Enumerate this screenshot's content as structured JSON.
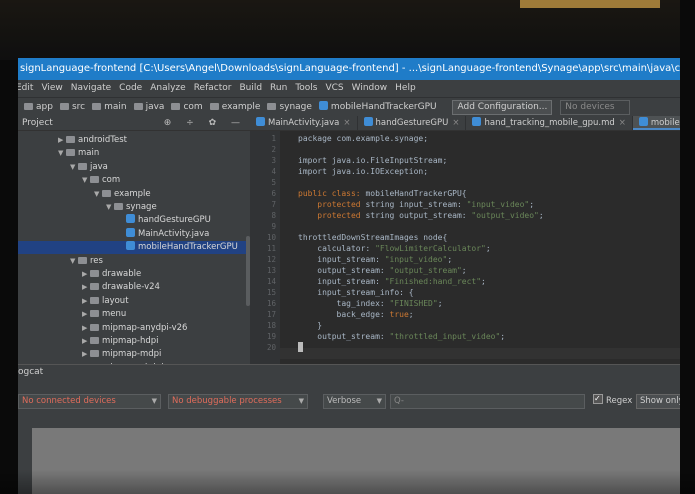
{
  "window": {
    "title": "signLanguage-frontend [C:\\Users\\Angel\\Downloads\\signLanguage-frontend] - ...\\signLanguage-frontend\\Synage\\app\\src\\main\\java\\com\\example\\synage\\mobileHandTrackerGPU"
  },
  "menu": [
    "Edit",
    "View",
    "Navigate",
    "Code",
    "Analyze",
    "Refactor",
    "Build",
    "Run",
    "Tools",
    "VCS",
    "Window",
    "Help"
  ],
  "nav": {
    "crumbs": [
      "app",
      "src",
      "main",
      "java",
      "com",
      "example",
      "synage",
      "mobileHandTrackerGPU"
    ],
    "config_label": "Add Configuration...",
    "device_label": "No devices"
  },
  "project": {
    "header": "Project",
    "tools": "⊕ ÷ ✿ —",
    "tree": [
      {
        "label": "androidTest",
        "depth": 1,
        "expanded": false,
        "kind": "folder"
      },
      {
        "label": "main",
        "depth": 1,
        "expanded": true,
        "kind": "folder"
      },
      {
        "label": "java",
        "depth": 2,
        "expanded": true,
        "kind": "folder"
      },
      {
        "label": "com",
        "depth": 3,
        "expanded": true,
        "kind": "folder"
      },
      {
        "label": "example",
        "depth": 4,
        "expanded": true,
        "kind": "folder"
      },
      {
        "label": "synage",
        "depth": 5,
        "expanded": true,
        "kind": "folder"
      },
      {
        "label": "handGestureGPU",
        "depth": 6,
        "kind": "file"
      },
      {
        "label": "MainActivity.java",
        "depth": 6,
        "kind": "file"
      },
      {
        "label": "mobileHandTrackerGPU",
        "depth": 6,
        "kind": "file",
        "selected": true
      },
      {
        "label": "res",
        "depth": 2,
        "expanded": true,
        "kind": "folder"
      },
      {
        "label": "drawable",
        "depth": 3,
        "expanded": false,
        "kind": "folder"
      },
      {
        "label": "drawable-v24",
        "depth": 3,
        "expanded": false,
        "kind": "folder"
      },
      {
        "label": "layout",
        "depth": 3,
        "expanded": false,
        "kind": "folder"
      },
      {
        "label": "menu",
        "depth": 3,
        "expanded": false,
        "kind": "folder"
      },
      {
        "label": "mipmap-anydpi-v26",
        "depth": 3,
        "expanded": false,
        "kind": "folder"
      },
      {
        "label": "mipmap-hdpi",
        "depth": 3,
        "expanded": false,
        "kind": "folder"
      },
      {
        "label": "mipmap-mdpi",
        "depth": 3,
        "expanded": false,
        "kind": "folder"
      },
      {
        "label": "mipmap-xhdpi",
        "depth": 3,
        "expanded": false,
        "kind": "folder"
      }
    ]
  },
  "tabs": [
    {
      "label": "MainActivity.java",
      "active": false
    },
    {
      "label": "handGestureGPU",
      "active": false
    },
    {
      "label": "hand_tracking_mobile_gpu.md",
      "active": false
    },
    {
      "label": "mobileHandTrackerGPU",
      "active": true
    }
  ],
  "editor": {
    "lines": [
      {
        "n": "1",
        "segs": [
          {
            "t": "package com.example.synage;",
            "c": ""
          }
        ]
      },
      {
        "n": "2",
        "segs": []
      },
      {
        "n": "3",
        "segs": [
          {
            "t": "import java.io.FileInputStream;",
            "c": ""
          }
        ]
      },
      {
        "n": "4",
        "segs": [
          {
            "t": "import java.io.IOException;",
            "c": ""
          }
        ]
      },
      {
        "n": "5",
        "segs": []
      },
      {
        "n": "6",
        "segs": [
          {
            "t": "public class: ",
            "c": "kw"
          },
          {
            "t": "mobileHandTrackerGPU{",
            "c": ""
          }
        ]
      },
      {
        "n": "7",
        "segs": [
          {
            "t": "    protected ",
            "c": "kw"
          },
          {
            "t": "string input_stream: ",
            "c": ""
          },
          {
            "t": "\"input_video\"",
            "c": "str"
          },
          {
            "t": ";",
            "c": ""
          }
        ]
      },
      {
        "n": "8",
        "segs": [
          {
            "t": "    protected ",
            "c": "kw"
          },
          {
            "t": "string output_stream: ",
            "c": ""
          },
          {
            "t": "\"output_video\"",
            "c": "str"
          },
          {
            "t": ";",
            "c": ""
          }
        ]
      },
      {
        "n": "9",
        "segs": []
      },
      {
        "n": "10",
        "segs": [
          {
            "t": "throttledDownStreamImages node{",
            "c": ""
          }
        ]
      },
      {
        "n": "11",
        "segs": [
          {
            "t": "    calculator: ",
            "c": ""
          },
          {
            "t": "\"FlowLimiterCalculator\"",
            "c": "str"
          },
          {
            "t": ";",
            "c": ""
          }
        ]
      },
      {
        "n": "12",
        "segs": [
          {
            "t": "    input_stream: ",
            "c": ""
          },
          {
            "t": "\"input_video\"",
            "c": "str"
          },
          {
            "t": ";",
            "c": ""
          }
        ]
      },
      {
        "n": "13",
        "segs": [
          {
            "t": "    output_stream: ",
            "c": ""
          },
          {
            "t": "\"output_stream\"",
            "c": "str"
          },
          {
            "t": ";",
            "c": ""
          }
        ]
      },
      {
        "n": "14",
        "segs": [
          {
            "t": "    input_stream: ",
            "c": ""
          },
          {
            "t": "\"Finished:hand_rect\"",
            "c": "str"
          },
          {
            "t": ";",
            "c": ""
          }
        ]
      },
      {
        "n": "15",
        "segs": [
          {
            "t": "    input_stream_info: {",
            "c": ""
          }
        ]
      },
      {
        "n": "16",
        "segs": [
          {
            "t": "        tag_index: ",
            "c": ""
          },
          {
            "t": "\"FINISHED\"",
            "c": "str"
          },
          {
            "t": ";",
            "c": ""
          }
        ]
      },
      {
        "n": "17",
        "segs": [
          {
            "t": "        back_edge: ",
            "c": ""
          },
          {
            "t": "true",
            "c": "kw"
          },
          {
            "t": ";",
            "c": ""
          }
        ]
      },
      {
        "n": "18",
        "segs": [
          {
            "t": "    }",
            "c": ""
          }
        ]
      },
      {
        "n": "19",
        "segs": [
          {
            "t": "    output_stream: ",
            "c": ""
          },
          {
            "t": "\"throttled_input_video\"",
            "c": "str"
          },
          {
            "t": ";",
            "c": ""
          }
        ]
      },
      {
        "n": "20",
        "segs": []
      }
    ]
  },
  "logcat": {
    "title": "ogcat",
    "device": "No connected devices",
    "process": "No debuggable processes",
    "level": "Verbose",
    "search_placeholder": "Q-",
    "regex_label": "Regex",
    "show_label": "Show only"
  },
  "colors": {
    "titlebar": "#1f7cc8",
    "keyword": "#cc7832",
    "string": "#6a8759",
    "selection": "#214283"
  }
}
